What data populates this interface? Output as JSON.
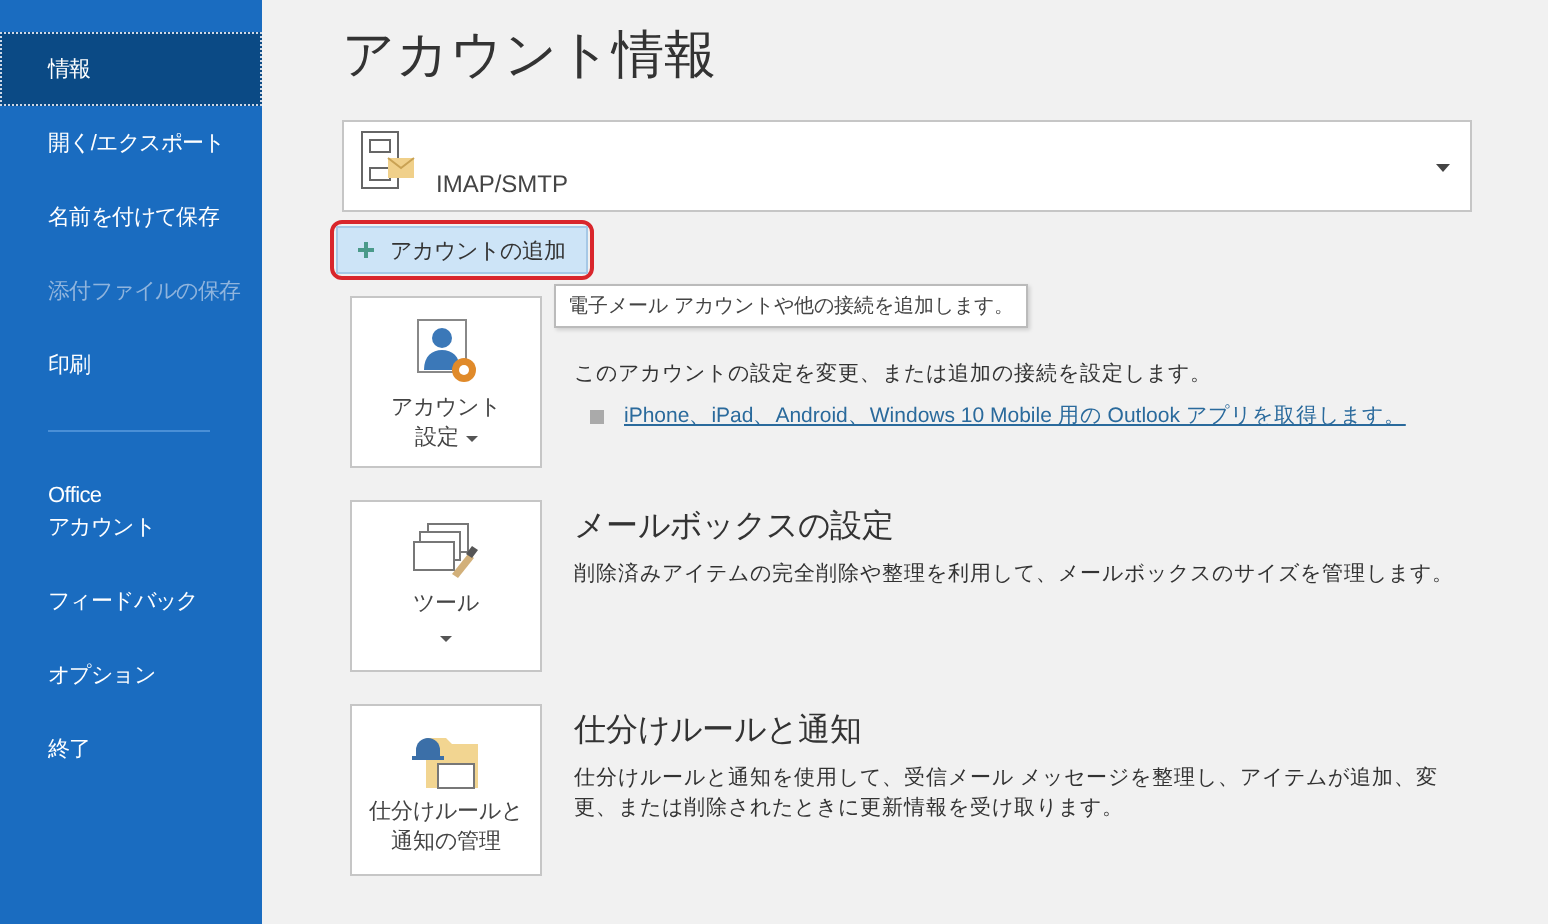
{
  "sidebar": {
    "items": [
      {
        "kind": "item",
        "label": "情報",
        "selected": true,
        "disabled": false
      },
      {
        "kind": "item",
        "label": "開く/エクスポート",
        "selected": false,
        "disabled": false
      },
      {
        "kind": "item",
        "label": "名前を付けて保存",
        "selected": false,
        "disabled": false
      },
      {
        "kind": "item",
        "label": "添付ファイルの保存",
        "selected": false,
        "disabled": true
      },
      {
        "kind": "item",
        "label": "印刷",
        "selected": false,
        "disabled": false
      },
      {
        "kind": "divider"
      },
      {
        "kind": "item",
        "label": "Office\nアカウント",
        "selected": false,
        "disabled": false
      },
      {
        "kind": "item",
        "label": "フィードバック",
        "selected": false,
        "disabled": false
      },
      {
        "kind": "item",
        "label": "オプション",
        "selected": false,
        "disabled": false
      },
      {
        "kind": "item",
        "label": "終了",
        "selected": false,
        "disabled": false
      }
    ]
  },
  "page_title": "アカウント情報",
  "account": {
    "type": "IMAP/SMTP"
  },
  "add_account_button": {
    "label": "アカウントの追加",
    "highlighted": true
  },
  "tooltip": "電子メール アカウントや他の接続を追加します。",
  "sections": [
    {
      "kind": "account",
      "button_lines": [
        "アカウント",
        "設定"
      ],
      "dropdown": true,
      "description": "このアカウントの設定を変更、または追加の接続を設定します。",
      "link": "iPhone、iPad、Android、Windows 10 Mobile 用の Outlook アプリを取得します。"
    },
    {
      "kind": "tools",
      "button_lines": [
        "ツール"
      ],
      "dropdown": true,
      "title": "メールボックスの設定",
      "description": "削除済みアイテムの完全削除や整理を利用して、メールボックスのサイズを管理します。"
    },
    {
      "kind": "rules",
      "button_lines": [
        "仕分けルールと",
        "通知の管理"
      ],
      "dropdown": false,
      "title": "仕分けルールと通知",
      "description": "仕分けルールと通知を使用して、受信メール メッセージを整理し、アイテムが追加、変更、または削除されたときに更新情報を受け取ります。"
    }
  ]
}
